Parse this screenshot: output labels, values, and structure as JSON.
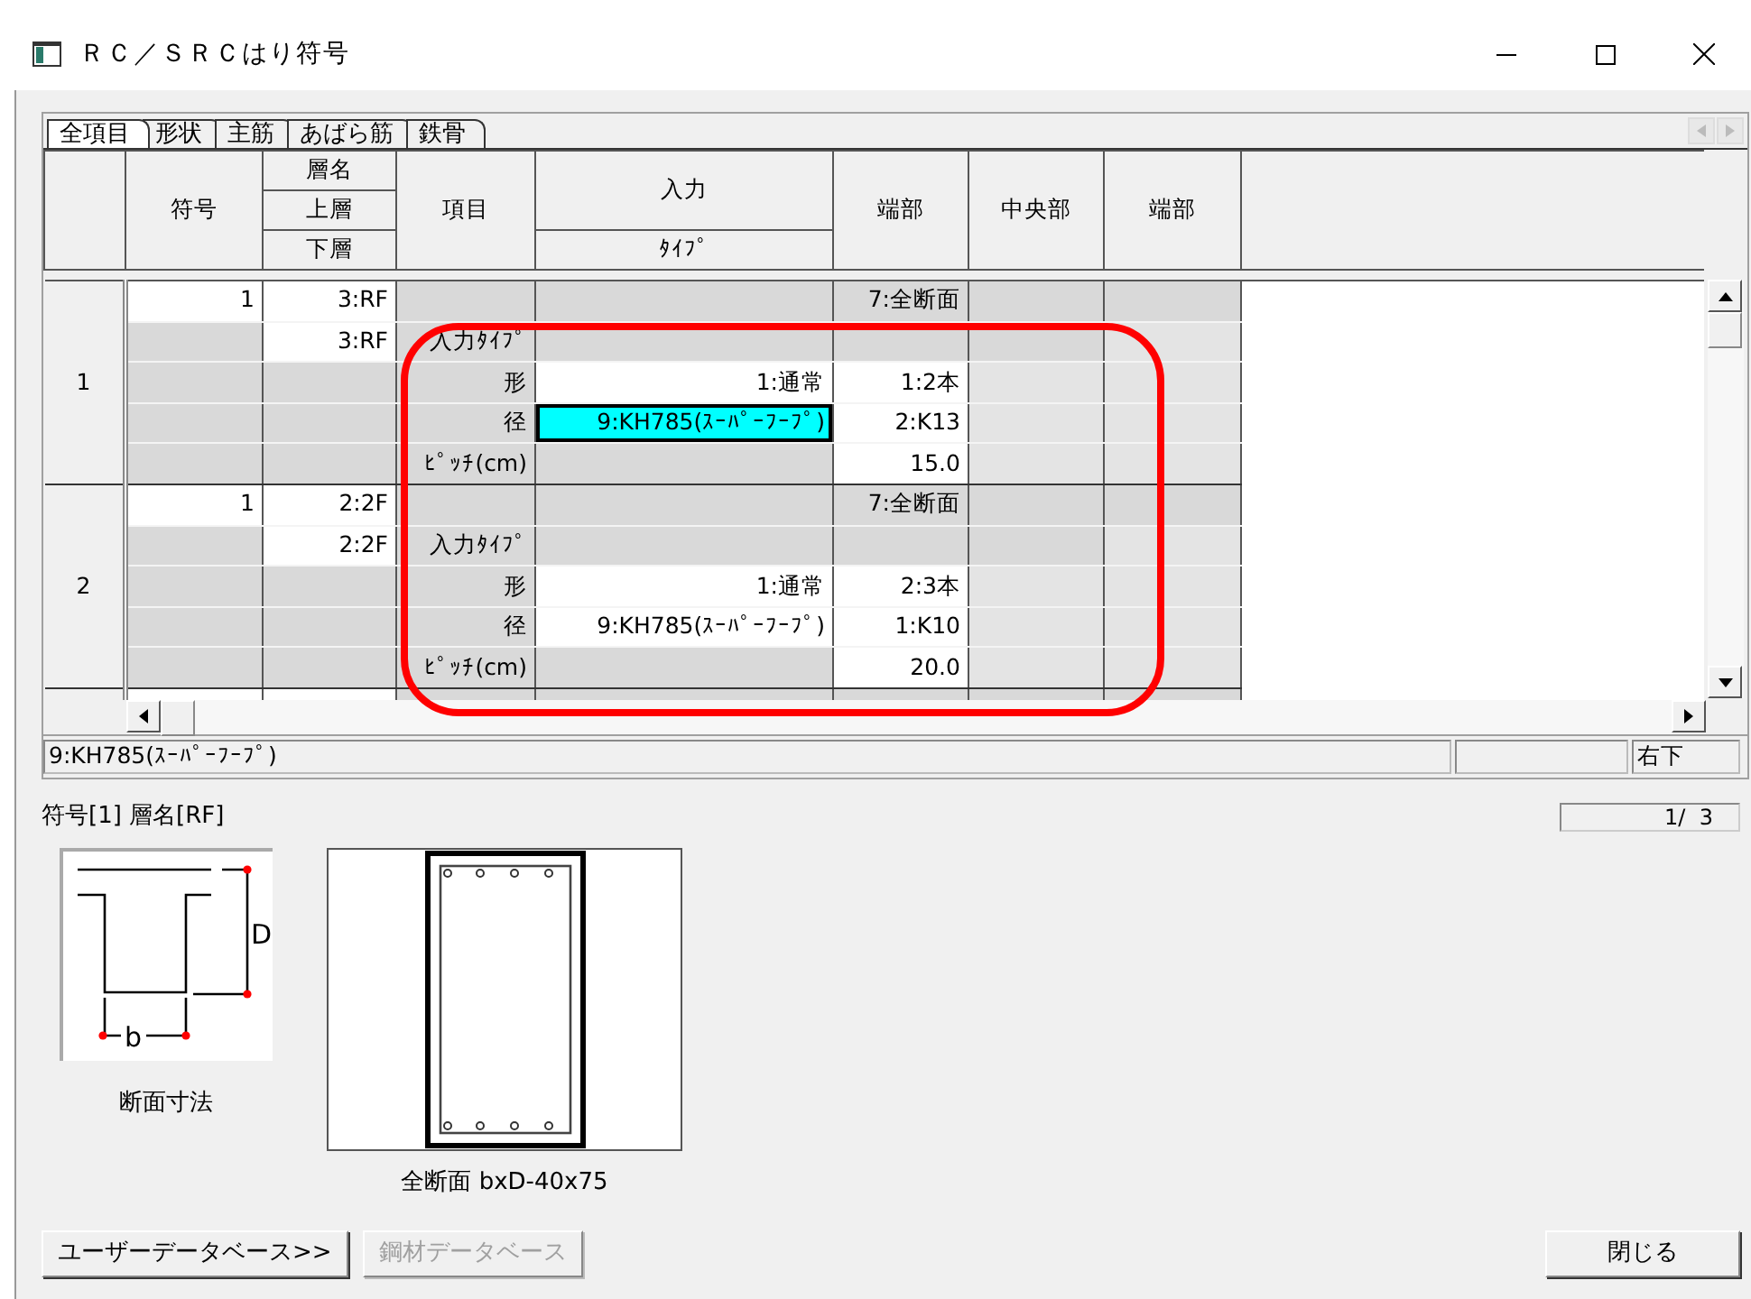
{
  "window": {
    "title": "ＲＣ／ＳＲＣはり符号"
  },
  "tabs": [
    {
      "label": "全項目",
      "selected": true
    },
    {
      "label": "形状",
      "selected": false
    },
    {
      "label": "主筋",
      "selected": false
    },
    {
      "label": "あばら筋",
      "selected": false
    },
    {
      "label": "鉄骨",
      "selected": false
    }
  ],
  "header": {
    "code": "符号",
    "floor_name": "層名",
    "upper": "上層",
    "lower": "下層",
    "item": "項目",
    "input": "入力",
    "type": "ﾀｲﾌﾟ",
    "end_1": "端部",
    "center": "中央部",
    "end_2": "端部"
  },
  "groups": [
    {
      "label": "1",
      "rows": [
        [
          {
            "text": "1",
            "kind": "input",
            "selected": false
          },
          {
            "text": "3:RF",
            "kind": "input",
            "selected": false
          },
          {
            "kind": "locked",
            "selected": false
          },
          {
            "kind": "locked",
            "selected": false
          },
          {
            "text": "7:全断面",
            "kind": "locked",
            "selected": false
          },
          {
            "kind": "locked",
            "selected": false
          },
          {
            "kind": "locked",
            "selected": false
          }
        ],
        [
          {
            "kind": "locked",
            "selected": false
          },
          {
            "text": "3:RF",
            "kind": "input",
            "selected": false
          },
          {
            "text": "入力ﾀｲﾌﾟ",
            "kind": "locked",
            "selected": false
          },
          {
            "kind": "locked",
            "selected": false
          },
          {
            "kind": "locked",
            "selected": false
          },
          {
            "kind": "locked",
            "selected": false
          },
          {
            "kind": "empty",
            "selected": false
          }
        ],
        [
          {
            "kind": "locked",
            "selected": false
          },
          {
            "kind": "locked",
            "selected": false
          },
          {
            "text": "形",
            "kind": "locked",
            "selected": false
          },
          {
            "text": "1:通常",
            "kind": "input",
            "selected": false
          },
          {
            "text": "1:2本",
            "kind": "input",
            "selected": false
          },
          {
            "kind": "empty",
            "selected": false
          },
          {
            "kind": "empty",
            "selected": false
          }
        ],
        [
          {
            "kind": "locked",
            "selected": false
          },
          {
            "kind": "locked",
            "selected": false
          },
          {
            "text": "径",
            "kind": "locked",
            "selected": false
          },
          {
            "text": "9:KH785(ｽｰﾊﾟｰﾌｰﾌﾟ)",
            "kind": "input",
            "selected": true
          },
          {
            "text": "2:K13",
            "kind": "input",
            "selected": false
          },
          {
            "kind": "empty",
            "selected": false
          },
          {
            "kind": "empty",
            "selected": false
          }
        ],
        [
          {
            "kind": "locked",
            "selected": false
          },
          {
            "kind": "locked",
            "selected": false
          },
          {
            "text": "ﾋﾟｯﾁ(cm)",
            "kind": "locked",
            "selected": false
          },
          {
            "kind": "locked",
            "selected": false
          },
          {
            "text": "15.0",
            "kind": "input",
            "selected": false
          },
          {
            "kind": "empty",
            "selected": false
          },
          {
            "kind": "empty",
            "selected": false
          }
        ]
      ]
    },
    {
      "label": "2",
      "rows": [
        [
          {
            "text": "1",
            "kind": "input",
            "selected": false
          },
          {
            "text": "2:2F",
            "kind": "input",
            "selected": false
          },
          {
            "kind": "locked",
            "selected": false
          },
          {
            "kind": "locked",
            "selected": false
          },
          {
            "text": "7:全断面",
            "kind": "locked",
            "selected": false
          },
          {
            "kind": "locked",
            "selected": false
          },
          {
            "kind": "locked",
            "selected": false
          }
        ],
        [
          {
            "kind": "locked",
            "selected": false
          },
          {
            "text": "2:2F",
            "kind": "input",
            "selected": false
          },
          {
            "text": "入力ﾀｲﾌﾟ",
            "kind": "locked",
            "selected": false
          },
          {
            "kind": "locked",
            "selected": false
          },
          {
            "kind": "locked",
            "selected": false
          },
          {
            "kind": "locked",
            "selected": false
          },
          {
            "kind": "empty",
            "selected": false
          }
        ],
        [
          {
            "kind": "locked",
            "selected": false
          },
          {
            "kind": "locked",
            "selected": false
          },
          {
            "text": "形",
            "kind": "locked",
            "selected": false
          },
          {
            "text": "1:通常",
            "kind": "input",
            "selected": false
          },
          {
            "text": "2:3本",
            "kind": "input",
            "selected": false
          },
          {
            "kind": "empty",
            "selected": false
          },
          {
            "kind": "empty",
            "selected": false
          }
        ],
        [
          {
            "kind": "locked",
            "selected": false
          },
          {
            "kind": "locked",
            "selected": false
          },
          {
            "text": "径",
            "kind": "locked",
            "selected": false
          },
          {
            "text": "9:KH785(ｽｰﾊﾟｰﾌｰﾌﾟ)",
            "kind": "input",
            "selected": false
          },
          {
            "text": "1:K10",
            "kind": "input",
            "selected": false
          },
          {
            "kind": "empty",
            "selected": false
          },
          {
            "kind": "empty",
            "selected": false
          }
        ],
        [
          {
            "kind": "locked",
            "selected": false
          },
          {
            "kind": "locked",
            "selected": false
          },
          {
            "text": "ﾋﾟｯﾁ(cm)",
            "kind": "locked",
            "selected": false
          },
          {
            "kind": "locked",
            "selected": false
          },
          {
            "text": "20.0",
            "kind": "input",
            "selected": false
          },
          {
            "kind": "empty",
            "selected": false
          },
          {
            "kind": "empty",
            "selected": false
          }
        ]
      ]
    }
  ],
  "status_bar": {
    "message": "9:KH785(ｽｰﾊﾟｰﾌｰﾌﾟ)",
    "corner": "右下"
  },
  "selection_info": "符号[1] 層名[RF]",
  "page_counter": "1/  3",
  "figures": [
    {
      "kind": "dimension",
      "caption": "断面寸法",
      "labels": [
        "D",
        "b"
      ]
    },
    {
      "kind": "section",
      "caption": "全断面 bxD-40x75"
    }
  ],
  "buttons": [
    {
      "label": "ユーザーデータベース>>",
      "disabled": false
    },
    {
      "label": "鋼材データベース",
      "disabled": true
    },
    {
      "label": "閉じる",
      "disabled": false
    }
  ]
}
